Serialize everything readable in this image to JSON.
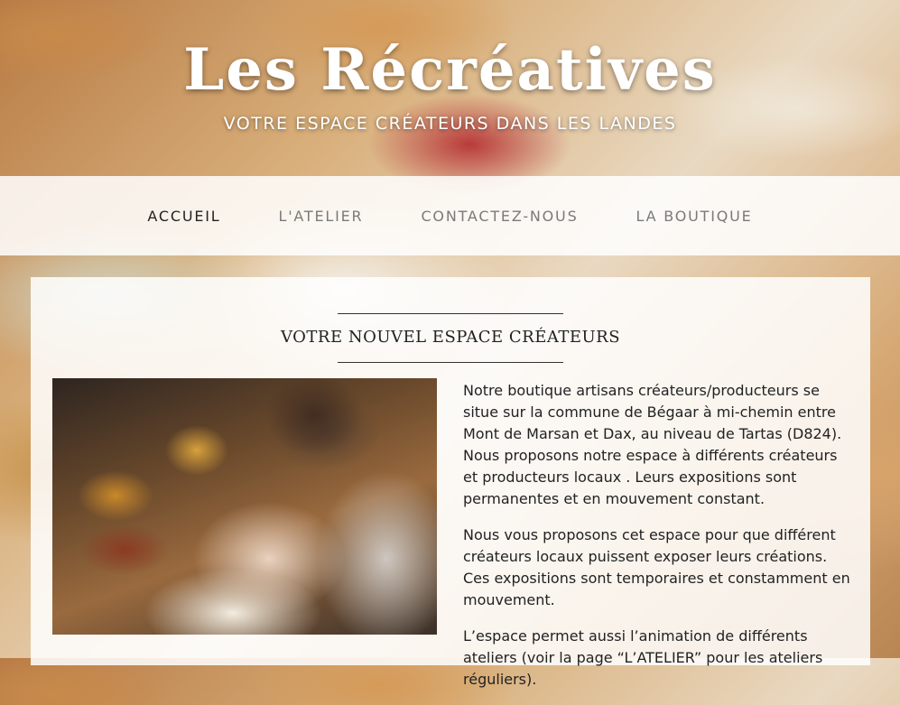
{
  "header": {
    "title": "Les Récréatives",
    "tagline": "VOTRE ESPACE CRÉATEURS DANS LES LANDES"
  },
  "nav": {
    "items": [
      {
        "label": "ACCUEIL",
        "active": true
      },
      {
        "label": "L'ATELIER",
        "active": false
      },
      {
        "label": "CONTACTEZ-NOUS",
        "active": false
      },
      {
        "label": "LA BOUTIQUE",
        "active": false
      }
    ]
  },
  "main": {
    "section_title": "VOTRE NOUVEL ESPACE CRÉATEURS",
    "paragraphs": [
      "Notre boutique artisans créateurs/producteurs se situe sur la commune de Bégaar à mi-chemin entre Mont de Marsan et Dax, au niveau de Tartas (D824). Nous proposons notre espace à différents créateurs et producteurs locaux . Leurs expositions sont permanentes et en mouvement constant.",
      "Nous vous proposons cet espace pour que différent créateurs locaux puissent exposer leurs créations. Ces expositions sont temporaires et constamment en mouvement.",
      "L’espace permet aussi l’animation de différents ateliers (voir la page “L’ATELIER” pour les ateliers réguliers)."
    ]
  },
  "colors": {
    "nav_active": "#222222",
    "nav_inactive": "#7a7a7a",
    "panel_bg": "rgba(255,255,255,0.86)"
  }
}
